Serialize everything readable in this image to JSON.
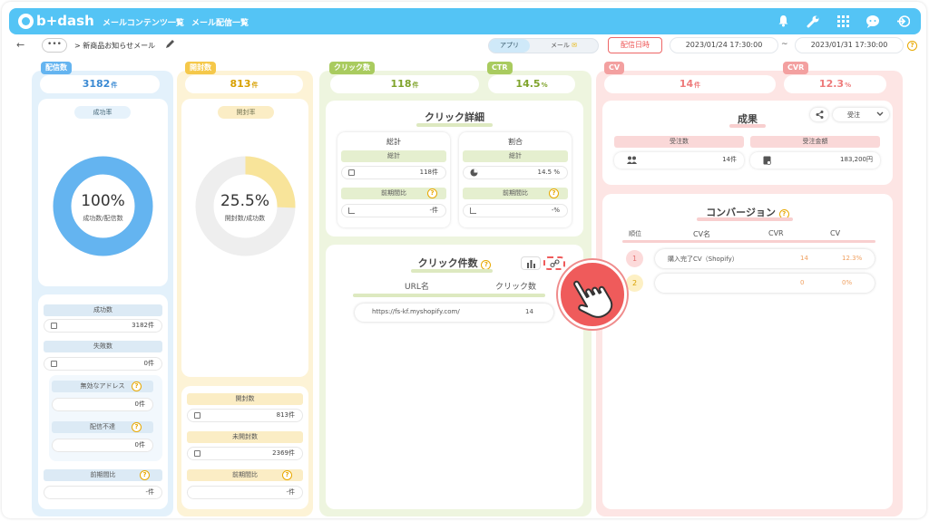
{
  "app": {
    "logo_text": "b+dash",
    "nav": [
      "メールコンテンツ一覧",
      "メール配信一覧"
    ]
  },
  "colors": {
    "topbar": "#54c4f5",
    "blue": "#64b4f0",
    "yellow": "#f5da6c",
    "green": "#b9d37c",
    "red": "#f3a0a0"
  },
  "subbar": {
    "back": "←",
    "dots": "•••",
    "breadcrumb": "> 新商品お知らせメール",
    "seg_app": "アプリ",
    "seg_mail": "メール",
    "date_button": "配信日時",
    "date_from": "2023/01/24 17:30:00",
    "tilde": "~",
    "date_to": "2023/01/31 17:30:00",
    "help": "?"
  },
  "delivery": {
    "tab": "配信数",
    "count": "3182",
    "unit": "件",
    "rate_chip": "成功率",
    "donut_value": "100%",
    "donut_caption": "成功数/配信数",
    "success_pct": 100,
    "success_label": "成功数",
    "success_value": "3182件",
    "fail_label": "失敗数",
    "fail_value": "0件",
    "invalid_label": "無効なアドレス",
    "invalid_value": "0件",
    "undeliverable_label": "配信不達",
    "undeliverable_value": "0件",
    "prev_label": "前期間比",
    "prev_value": "-件"
  },
  "open": {
    "tab": "開封数",
    "count": "813",
    "unit": "件",
    "rate_chip": "開封率",
    "donut_value": "25.5%",
    "donut_caption": "開封数/成功数",
    "open_pct": 25.5,
    "open_label": "開封数",
    "open_value": "813件",
    "unopen_label": "未開封数",
    "unopen_value": "2369件",
    "prev_label": "前期間比",
    "prev_value": "-件"
  },
  "click": {
    "tab": "クリック数",
    "count": "118",
    "unit": "件",
    "ctr_tab": "CTR",
    "ctr": "14.5",
    "ctr_unit": "%",
    "detail_title": "クリック詳細",
    "total_col": "総計",
    "total_sub": "総計",
    "total_value": "118件",
    "total_prev": "前期間比",
    "total_prev_value": "-件",
    "ratio_col": "割合",
    "ratio_sub": "総計",
    "ratio_value": "14.5 %",
    "ratio_prev": "前期間比",
    "ratio_prev_value": "-%",
    "count_title": "クリック件数",
    "url_col": "URL名",
    "count_col": "クリック数",
    "rows": [
      {
        "url": "https://fs-kf.myshopify.com/",
        "count": "14"
      }
    ]
  },
  "cv": {
    "tab": "CV",
    "count": "14",
    "unit": "件",
    "cvr_tab": "CVR",
    "cvr": "12.3",
    "cvr_unit": "%",
    "result_title": "成果",
    "select_value": "受注",
    "order_count_label": "受注数",
    "order_count_value": "14件",
    "order_amount_label": "受注金額",
    "order_amount_value": "183,200円",
    "conv_title": "コンバージョン",
    "headers": [
      "順位",
      "CV名",
      "CVR",
      "CV"
    ],
    "rows": [
      {
        "rank": "1",
        "name": "購入完了CV（Shopify）",
        "cvr": "14",
        "cv": "12.3%"
      },
      {
        "rank": "2",
        "name": "",
        "cvr": "0",
        "cv": "0%"
      }
    ]
  }
}
